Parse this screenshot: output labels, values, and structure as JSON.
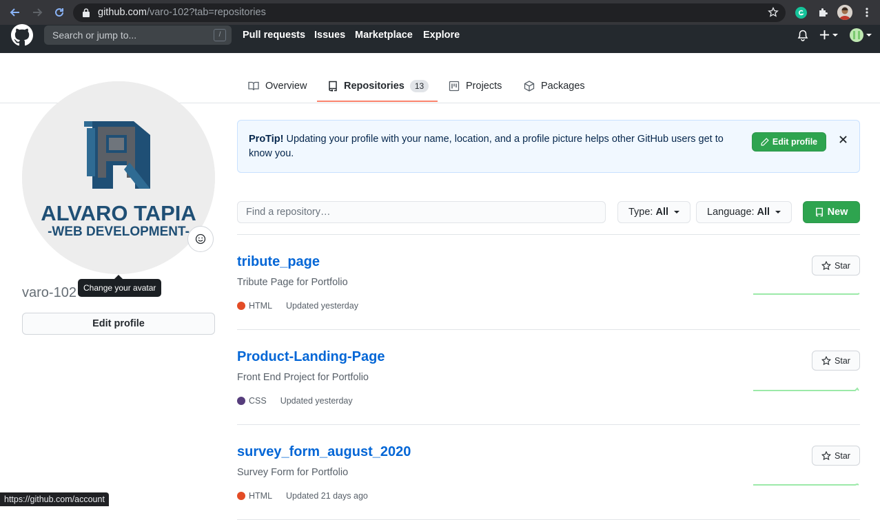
{
  "browser": {
    "url_host": "github.com",
    "url_path": "/varo-102?tab=repositories"
  },
  "header": {
    "search_placeholder": "Search or jump to...",
    "search_shortcut": "/",
    "nav": [
      "Pull requests",
      "Issues",
      "Marketplace",
      "Explore"
    ]
  },
  "tabs": [
    {
      "label": "Overview",
      "icon": "book-icon"
    },
    {
      "label": "Repositories",
      "icon": "repo-icon",
      "count": "13",
      "selected": true
    },
    {
      "label": "Projects",
      "icon": "project-icon"
    },
    {
      "label": "Packages",
      "icon": "package-icon"
    }
  ],
  "profile": {
    "avatar_line1": "ALVARO TAPIA",
    "avatar_line2": "-WEB DEVELOPMENT-",
    "tooltip": "Change your avatar",
    "username": "varo-102",
    "edit_button": "Edit profile"
  },
  "protip": {
    "lead": "ProTip!",
    "text": "Updating your profile with your name, location, and a profile picture helps other GitHub users get to know you.",
    "button": "Edit profile"
  },
  "filters": {
    "search_placeholder": "Find a repository…",
    "type_label": "Type:",
    "type_value": "All",
    "language_label": "Language:",
    "language_value": "All",
    "new_button": "New"
  },
  "repos": [
    {
      "name": "tribute_page",
      "description": "Tribute Page for Portfolio",
      "language": "HTML",
      "language_color": "#e34c26",
      "updated": "Updated yesterday",
      "star_label": "Star"
    },
    {
      "name": "Product-Landing-Page",
      "description": "Front End Project for Portfolio",
      "language": "CSS",
      "language_color": "#563d7c",
      "updated": "Updated yesterday",
      "star_label": "Star"
    },
    {
      "name": "survey_form_august_2020",
      "description": "Survey Form for Portfolio",
      "language": "HTML",
      "language_color": "#e34c26",
      "updated": "Updated 21 days ago",
      "star_label": "Star"
    }
  ],
  "status_bar": "https://github.com/account",
  "colors": {
    "accent_green": "#2ea44f",
    "link_blue": "#0366d6",
    "tab_underline": "#f9826c",
    "header_dark": "#24292e"
  }
}
